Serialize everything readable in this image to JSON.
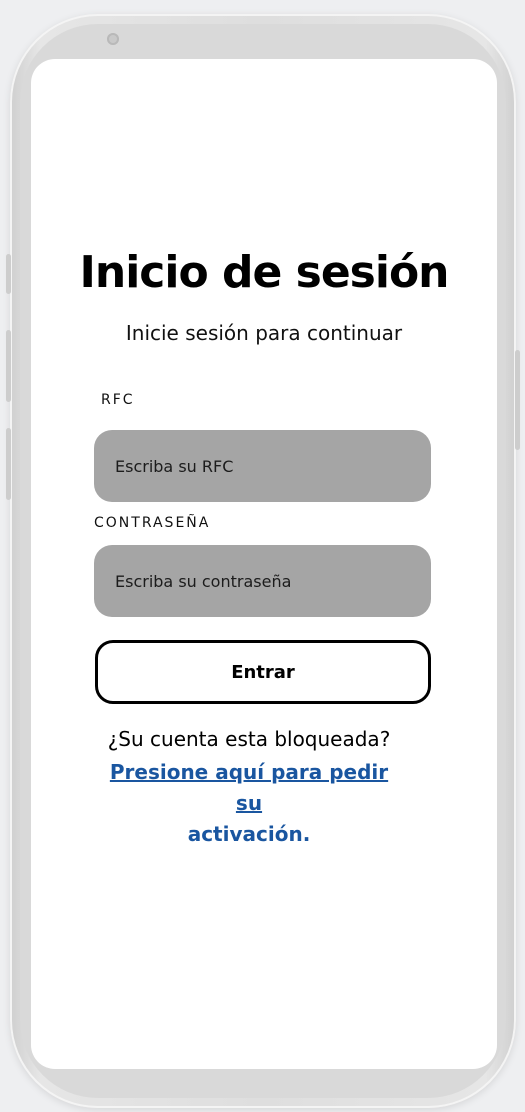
{
  "login": {
    "title": "Inicio de sesión",
    "subtitle": "Inicie sesión para continuar",
    "rfc_label": "RFC",
    "rfc_placeholder": "Escriba su RFC",
    "password_label": "CONTRASEÑA",
    "password_placeholder": "Escriba su contraseña",
    "submit_label": "Entrar",
    "locked_question": "¿Su cuenta esta bloqueada?",
    "activation_link_line1": "Presione aquí para pedir su",
    "activation_link_line2": "activación."
  },
  "colors": {
    "input_background": "#a5a5a5",
    "link": "#1a56a0",
    "device_frame": "#dedede"
  }
}
